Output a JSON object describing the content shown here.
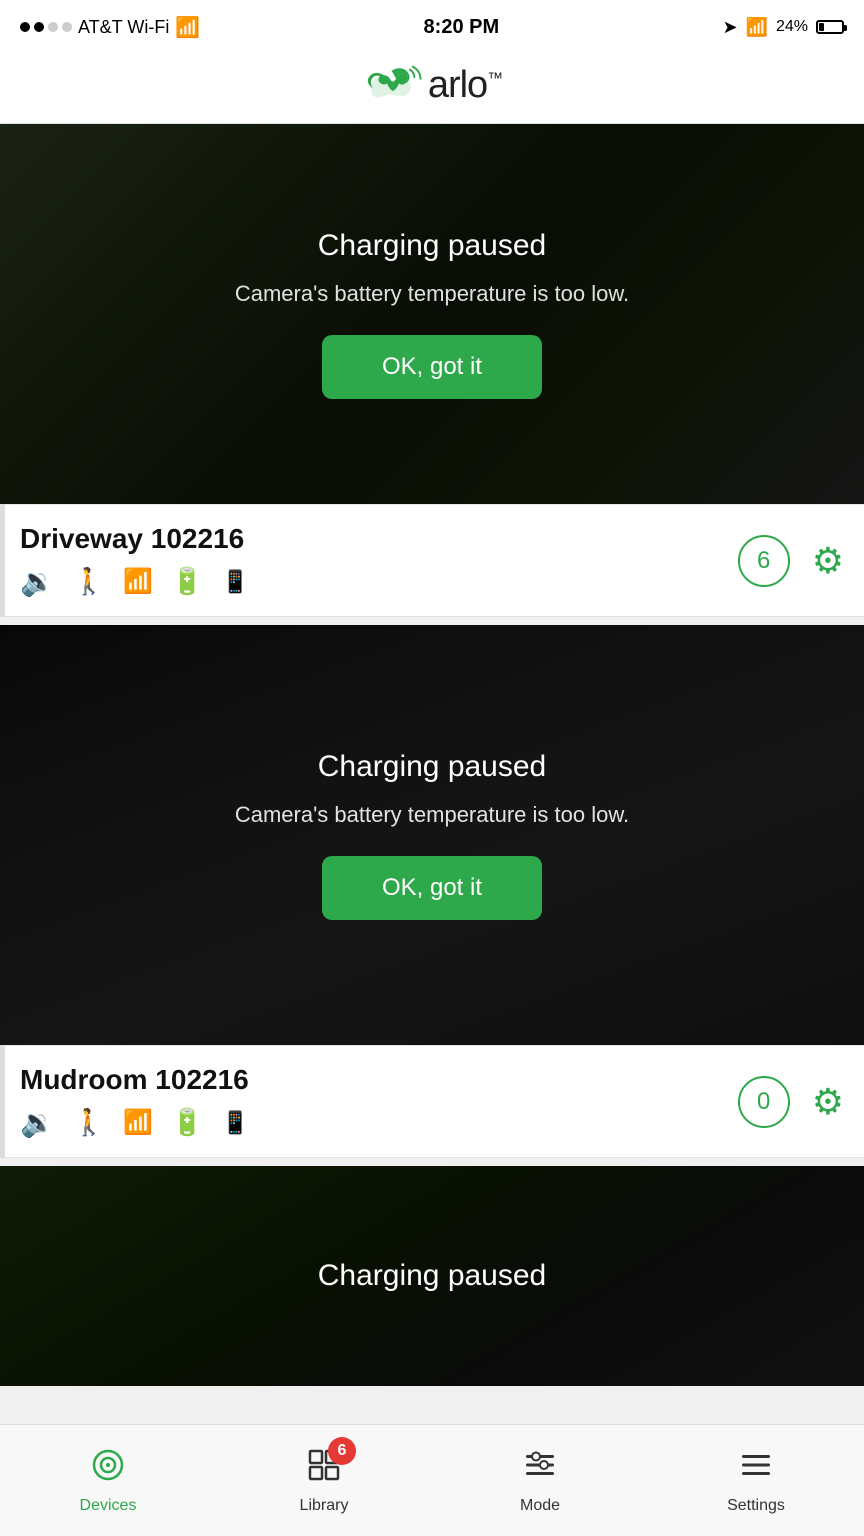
{
  "statusBar": {
    "carrier": "AT&T Wi-Fi",
    "time": "8:20 PM",
    "batteryPercent": "24%"
  },
  "header": {
    "logoText": "arlo",
    "tm": "™"
  },
  "camera1": {
    "name": "Driveway 102216",
    "notifCount": "6",
    "overlay": {
      "title": "Charging paused",
      "subtitle": "Camera's battery temperature is too low.",
      "buttonLabel": "OK, got it"
    }
  },
  "camera2": {
    "name": "Mudroom 102216",
    "notifCount": "0",
    "overlay": {
      "title": "Charging paused",
      "subtitle": "Camera's battery temperature is too low.",
      "buttonLabel": "OK, got it"
    }
  },
  "camera3": {
    "overlay": {
      "title": "Charging paused"
    }
  },
  "bottomNav": {
    "devices": "Devices",
    "library": "Library",
    "libraryBadge": "6",
    "mode": "Mode",
    "settings": "Settings"
  }
}
